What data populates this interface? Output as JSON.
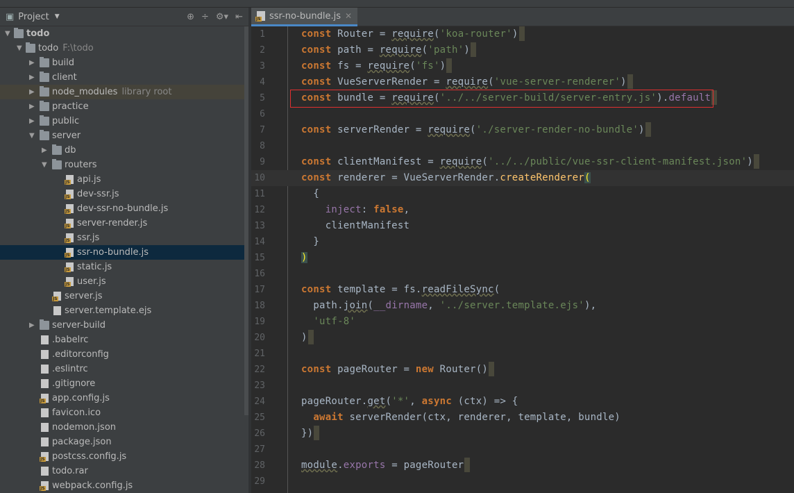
{
  "project_panel": {
    "title": "Project",
    "icons": [
      "locate-icon",
      "collapse-all-icon",
      "gear-icon",
      "hide-icon"
    ]
  },
  "tree": [
    {
      "label": "todo",
      "depth": 0,
      "type": "module",
      "expanded": true,
      "bold": true
    },
    {
      "label": "todo",
      "suffix": "F:\\todo",
      "depth": 1,
      "type": "folder",
      "expanded": true
    },
    {
      "label": "build",
      "depth": 2,
      "type": "folder",
      "expanded": false
    },
    {
      "label": "client",
      "depth": 2,
      "type": "folder",
      "expanded": false
    },
    {
      "label": "node_modules",
      "suffix": "library root",
      "depth": 2,
      "type": "folder",
      "expanded": false,
      "highlighted": true
    },
    {
      "label": "practice",
      "depth": 2,
      "type": "folder",
      "expanded": false
    },
    {
      "label": "public",
      "depth": 2,
      "type": "folder",
      "expanded": false
    },
    {
      "label": "server",
      "depth": 2,
      "type": "folder",
      "expanded": true
    },
    {
      "label": "db",
      "depth": 3,
      "type": "folder",
      "expanded": false
    },
    {
      "label": "routers",
      "depth": 3,
      "type": "folder",
      "expanded": true
    },
    {
      "label": "api.js",
      "depth": 4,
      "type": "js"
    },
    {
      "label": "dev-ssr.js",
      "depth": 4,
      "type": "js"
    },
    {
      "label": "dev-ssr-no-bundle.js",
      "depth": 4,
      "type": "js"
    },
    {
      "label": "server-render.js",
      "depth": 4,
      "type": "js"
    },
    {
      "label": "ssr.js",
      "depth": 4,
      "type": "js"
    },
    {
      "label": "ssr-no-bundle.js",
      "depth": 4,
      "type": "js",
      "selected": true
    },
    {
      "label": "static.js",
      "depth": 4,
      "type": "js"
    },
    {
      "label": "user.js",
      "depth": 4,
      "type": "js"
    },
    {
      "label": "server.js",
      "depth": 3,
      "type": "js"
    },
    {
      "label": "server.template.ejs",
      "depth": 3,
      "type": "file"
    },
    {
      "label": "server-build",
      "depth": 2,
      "type": "folder",
      "expanded": false
    },
    {
      "label": ".babelrc",
      "depth": 2,
      "type": "file"
    },
    {
      "label": ".editorconfig",
      "depth": 2,
      "type": "file"
    },
    {
      "label": ".eslintrc",
      "depth": 2,
      "type": "file"
    },
    {
      "label": ".gitignore",
      "depth": 2,
      "type": "file"
    },
    {
      "label": "app.config.js",
      "depth": 2,
      "type": "js"
    },
    {
      "label": "favicon.ico",
      "depth": 2,
      "type": "file"
    },
    {
      "label": "nodemon.json",
      "depth": 2,
      "type": "file"
    },
    {
      "label": "package.json",
      "depth": 2,
      "type": "file"
    },
    {
      "label": "postcss.config.js",
      "depth": 2,
      "type": "js"
    },
    {
      "label": "todo.rar",
      "depth": 2,
      "type": "file"
    },
    {
      "label": "webpack.config.js",
      "depth": 2,
      "type": "js"
    }
  ],
  "editor": {
    "tab": "ssr-no-bundle.js",
    "colors": {
      "keyword": "#cc7832",
      "string": "#6a8759",
      "property": "#9876aa",
      "function": "#ffc66d",
      "text": "#a9b7c6"
    },
    "highlighted_line": 5,
    "current_line": 10,
    "lines": [
      {
        "n": 1,
        "m": 1,
        "t": [
          [
            "const",
            "k"
          ],
          " Router = ",
          [
            "require",
            "u"
          ],
          "(",
          [
            "'koa-router'",
            "s"
          ],
          ")"
        ]
      },
      {
        "n": 2,
        "m": 1,
        "t": [
          [
            "const",
            "k"
          ],
          " path = ",
          [
            "require",
            "u"
          ],
          "(",
          [
            "'path'",
            "s"
          ],
          ")"
        ]
      },
      {
        "n": 3,
        "m": 1,
        "t": [
          [
            "const",
            "k"
          ],
          " fs = ",
          [
            "require",
            "u"
          ],
          "(",
          [
            "'fs'",
            "s"
          ],
          ")"
        ]
      },
      {
        "n": 4,
        "m": 1,
        "t": [
          [
            "const",
            "k"
          ],
          " VueServerRender = ",
          [
            "require",
            "u"
          ],
          "(",
          [
            "'vue-server-renderer'",
            "s"
          ],
          ")"
        ]
      },
      {
        "n": 5,
        "m": 1,
        "t": [
          [
            "const",
            "k"
          ],
          " bundle = ",
          [
            "require",
            "u"
          ],
          "(",
          [
            "'../../server-build/server-entry.js'",
            "s"
          ],
          ").",
          [
            "default",
            "p"
          ]
        ]
      },
      {
        "n": 6,
        "t": []
      },
      {
        "n": 7,
        "m": 1,
        "t": [
          [
            "const",
            "k"
          ],
          " serverRender = ",
          [
            "require",
            "u"
          ],
          "(",
          [
            "'./server-render-no-bundle'",
            "s"
          ],
          ")"
        ]
      },
      {
        "n": 8,
        "t": []
      },
      {
        "n": 9,
        "m": 1,
        "t": [
          [
            "const",
            "k"
          ],
          " clientManifest = ",
          [
            "require",
            "u"
          ],
          "(",
          [
            "'../../public/vue-ssr-client-manifest.json'",
            "s"
          ],
          ")"
        ]
      },
      {
        "n": 10,
        "t": [
          [
            "const",
            "k"
          ],
          " renderer = VueServerRender.",
          [
            "createRenderer",
            "f"
          ],
          [
            "(",
            "br"
          ]
        ]
      },
      {
        "n": 11,
        "t": [
          "  {"
        ]
      },
      {
        "n": 12,
        "t": [
          "    ",
          [
            "inject",
            "p"
          ],
          ": ",
          [
            "false",
            "k"
          ],
          ","
        ]
      },
      {
        "n": 13,
        "t": [
          "    clientManifest"
        ]
      },
      {
        "n": 14,
        "t": [
          "  }"
        ]
      },
      {
        "n": 15,
        "t": [
          [
            ")",
            "br"
          ]
        ]
      },
      {
        "n": 16,
        "t": []
      },
      {
        "n": 17,
        "t": [
          [
            "const",
            "k"
          ],
          " template = fs.",
          [
            "readFileSync",
            "u"
          ],
          "("
        ]
      },
      {
        "n": 18,
        "t": [
          "  path.",
          [
            "join",
            "u"
          ],
          "(",
          [
            "__dirname",
            "p"
          ],
          ", ",
          [
            "'../server.template.ejs'",
            "s"
          ],
          "),"
        ]
      },
      {
        "n": 19,
        "t": [
          "  ",
          [
            "'utf-8'",
            "s"
          ]
        ]
      },
      {
        "n": 20,
        "m": 1,
        "t": [
          ")"
        ]
      },
      {
        "n": 21,
        "t": []
      },
      {
        "n": 22,
        "m": 1,
        "t": [
          [
            "const",
            "k"
          ],
          " pageRouter = ",
          [
            "new",
            "k"
          ],
          " Router()"
        ]
      },
      {
        "n": 23,
        "t": []
      },
      {
        "n": 24,
        "t": [
          "pageRouter.",
          [
            "get",
            "u"
          ],
          "(",
          [
            "'*'",
            "s"
          ],
          ", ",
          [
            "async",
            "k"
          ],
          " (ctx) => {"
        ]
      },
      {
        "n": 25,
        "t": [
          "  ",
          [
            "await",
            "k"
          ],
          " serverRender(ctx, renderer, template, bundle)"
        ]
      },
      {
        "n": 26,
        "m": 1,
        "t": [
          "})"
        ]
      },
      {
        "n": 27,
        "t": []
      },
      {
        "n": 28,
        "m": 1,
        "t": [
          [
            "module",
            "u"
          ],
          ".",
          [
            "exports",
            "p"
          ],
          " = pageRouter"
        ]
      },
      {
        "n": 29,
        "t": []
      }
    ]
  }
}
